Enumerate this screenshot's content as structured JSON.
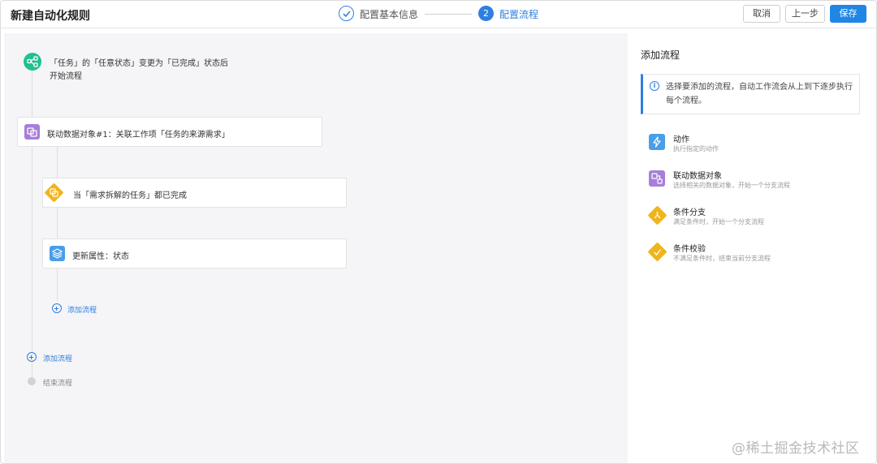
{
  "header": {
    "title": "新建自动化规则",
    "steps": [
      {
        "label": "配置基本信息",
        "state": "done"
      },
      {
        "label": "配置流程",
        "number": "2",
        "state": "active"
      }
    ],
    "buttons": {
      "cancel": "取消",
      "prev": "上一步",
      "save": "保存"
    }
  },
  "flow": {
    "trigger": {
      "line1": "「任务」的「任意状态」变更为「已完成」状态后",
      "line2": "开始流程"
    },
    "nodes": [
      {
        "label": "联动数据对象#1：关联工作项「任务的来源需求」",
        "icon": "link-object-icon"
      },
      {
        "label": "当「需求拆解的任务」都已完成",
        "icon": "condition-check-icon"
      },
      {
        "label": "更新属性：状态",
        "icon": "layers-icon"
      }
    ],
    "inner_add": "添加流程",
    "outer_add": "添加流程",
    "end": "结束流程"
  },
  "panel": {
    "title": "添加流程",
    "info": "选择要添加的流程，自动工作流会从上到下逐步执行每个流程。",
    "options": [
      {
        "title": "动作",
        "desc": "执行指定的动作",
        "icon": "lightning-icon"
      },
      {
        "title": "联动数据对象",
        "desc": "选择相关的数据对象，开始一个分支流程",
        "icon": "link-object-icon"
      },
      {
        "title": "条件分支",
        "desc": "满足条件时，开始一个分支流程",
        "icon": "branch-icon"
      },
      {
        "title": "条件校验",
        "desc": "不满足条件时，结束当前分支流程",
        "icon": "check-icon"
      }
    ]
  },
  "watermark": "@稀土掘金技术社区",
  "colors": {
    "primary": "#1f86e6",
    "trigger": "#20c092",
    "link_object": "#a77fd8",
    "condition": "#f0b41c",
    "action": "#4a9ee8"
  }
}
